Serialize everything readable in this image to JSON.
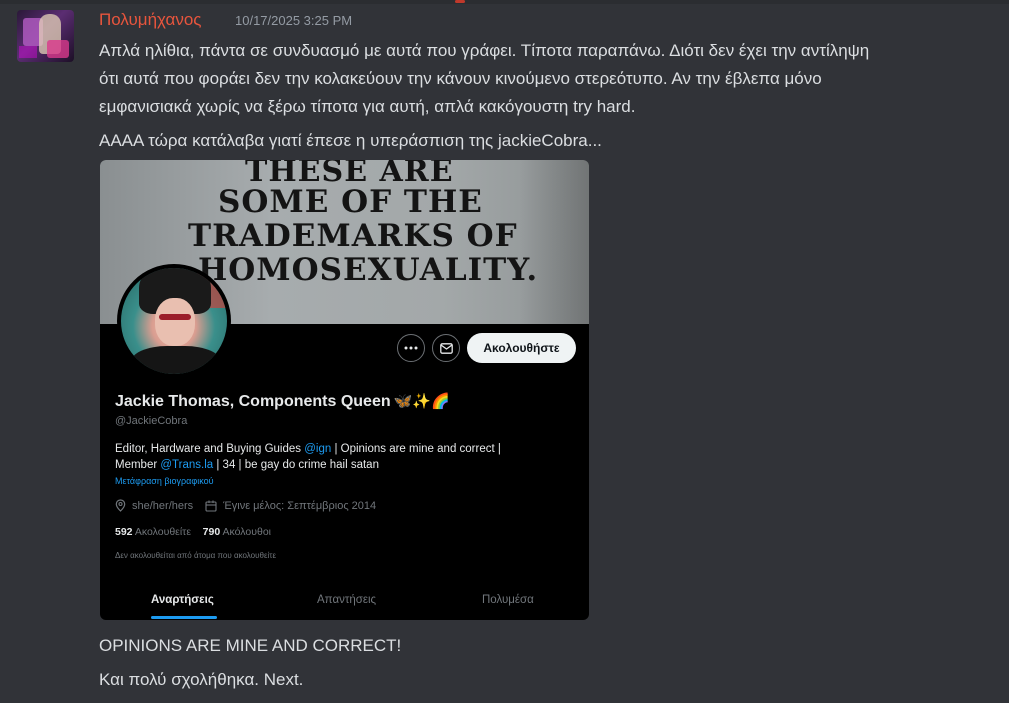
{
  "message": {
    "username": "Πολυμήχανος",
    "timestamp": "10/17/2025 3:25 PM",
    "lines": [
      "Απλά ηλίθια, πάντα σε συνδυασμό με αυτά που γράφει. Τίποτα παραπάνω. Διότι δεν έχει την αντίληψη",
      "ότι αυτά που φοράει δεν την κολακεύουν την κάνουν κινούμενο στερεότυπο. Αν την έβλεπα μόνο",
      "εμφανισιακά χωρίς να ξέρω τίποτα για αυτή, απλά κακόγουστη try hard.",
      "ΑΑΑΑ τώρα κατάλαβα γιατί έπεσε η υπεράσπιση της jackieCobra..."
    ],
    "after_lines": [
      "OPINIONS ARE MINE AND CORRECT!",
      "Και πολύ σχολήθηκα. Next."
    ]
  },
  "embed": {
    "banner_lines": [
      "THESE ARE",
      "SOME OF THE",
      "TRADEMARKS OF",
      "HOMOSEXUALITY."
    ],
    "follow_label": "Ακολουθήστε",
    "display_name": "Jackie Thomas, Components Queen",
    "name_emojis": "🦋✨🌈",
    "handle": "@JackieCobra",
    "bio_line1_a": "Editor, Hardware and Buying Guides ",
    "bio_line1_link": "@ign",
    "bio_line1_b": " | Opinions are mine and correct |",
    "bio_line2_a": "Member ",
    "bio_line2_link": "@Trans.la",
    "bio_line2_b": " | 34 | be gay do crime hail satan",
    "translate_label": "Μετάφραση βιογραφικού",
    "pronouns": "she/her/hers",
    "joined": "Έγινε μέλος: Σεπτέμβριος 2014",
    "following_count": "592",
    "following_label": "Ακολουθείτε",
    "followers_count": "790",
    "followers_label": "Ακόλουθοι",
    "note": "Δεν ακολουθείται από άτομα που ακολουθείτε",
    "tabs": [
      "Αναρτήσεις",
      "Απαντήσεις",
      "Πολυμέσα"
    ]
  },
  "colors": {
    "username": "#e8553d",
    "background": "#313338",
    "link": "#1d9bf0"
  }
}
